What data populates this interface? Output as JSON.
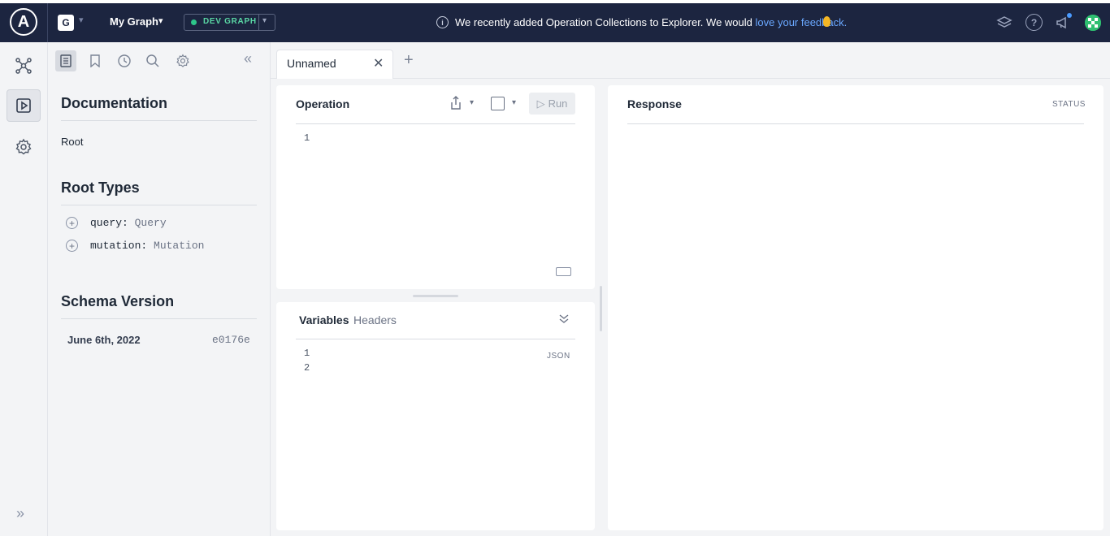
{
  "topbar": {
    "logo": "A",
    "org_badge": "G",
    "graph_name": "My Graph",
    "variant_label": "DEV GRAPH",
    "announcement_text": "We recently added Operation Collections to Explorer. We would ",
    "announcement_link": "love your feedback.",
    "icons": [
      "info-icon",
      "ear-icon",
      "layers-icon",
      "help-icon",
      "megaphone-icon",
      "avatar"
    ],
    "help_glyph": "?"
  },
  "leftnav": {
    "items": [
      "graph-icon",
      "explorer-play-icon",
      "settings-icon"
    ],
    "expand_glyph": "»"
  },
  "docs": {
    "title": "Documentation",
    "breadcrumb": "Root",
    "root_types_title": "Root Types",
    "root_types": [
      {
        "name": "query:",
        "type": "Query"
      },
      {
        "name": "mutation:",
        "type": "Mutation"
      }
    ],
    "schema_version_title": "Schema Version",
    "schema_version_date": "June 6th, 2022",
    "schema_version_hash": "e0176e",
    "collapse_glyph": "«"
  },
  "tabs": {
    "active_label": "Unnamed",
    "close_glyph": "✕",
    "new_glyph": "+"
  },
  "operation": {
    "title": "Operation",
    "run_label": "Run",
    "line_numbers": [
      "1"
    ]
  },
  "variables": {
    "tab_variables": "Variables",
    "tab_headers": "Headers",
    "format_label": "JSON",
    "line_numbers": [
      "1",
      "2"
    ]
  },
  "response": {
    "title": "Response",
    "status_label": "STATUS"
  },
  "colors": {
    "topbar_bg": "#1c2540",
    "link": "#6aa8ff",
    "dev_dot": "#2dc68a",
    "notification_dot": "#4a9bff"
  }
}
